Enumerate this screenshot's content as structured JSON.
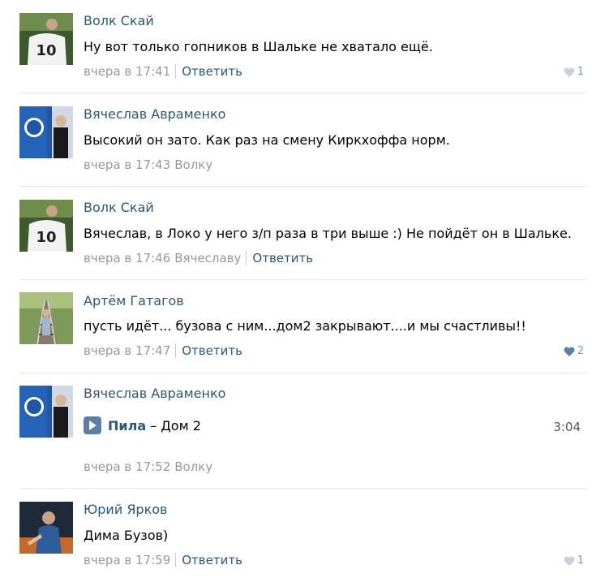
{
  "colors": {
    "link": "#2b587a",
    "meta": "#999999",
    "like": "#7d97b3",
    "divider": "#e7eaed",
    "play_button": "#5b7fa6"
  },
  "comments": [
    {
      "author": "Волк Скай",
      "avatar_icon": "football-jersey-10-avatar",
      "text": "Ну вот только гопников в Шальке не хватало ещё.",
      "time": "вчера в 17:41",
      "reply_label": "Ответить",
      "likes": "1"
    },
    {
      "author": "Вячеслав Авраменко",
      "avatar_icon": "schalke-flag-avatar",
      "text": "Высокий он зато. Как раз на смену Киркхоффа норм.",
      "time": "вчера в 17:43",
      "reply_to": "Волку"
    },
    {
      "author": "Волк Скай",
      "avatar_icon": "football-jersey-10-avatar",
      "text": "Вячеслав, в Локо у него з/п раза в три выше :) Не пойдёт он в Шальке.",
      "time": "вчера в 17:46",
      "reply_to": "Вячеславу",
      "reply_label": "Ответить"
    },
    {
      "author": "Артём Гатагов",
      "avatar_icon": "railroad-tracks-avatar",
      "text": "пусть идёт... бузова с ним...дом2 закрывают....и мы счастливы!!",
      "time": "вчера в 17:47",
      "reply_label": "Ответить",
      "likes": "2"
    },
    {
      "author": "Вячеслав Авраменко",
      "avatar_icon": "schalke-flag-avatar",
      "audio": {
        "artist": "Пила",
        "dash": " – ",
        "title": "Дом 2",
        "duration": "3:04"
      },
      "time": "вчера в 17:52",
      "reply_to": "Волку"
    },
    {
      "author": "Юрий Ярков",
      "avatar_icon": "dark-portrait-avatar",
      "text": "Дима Бузов)",
      "time": "вчера в 17:59",
      "reply_label": "Ответить",
      "likes": "1"
    }
  ]
}
